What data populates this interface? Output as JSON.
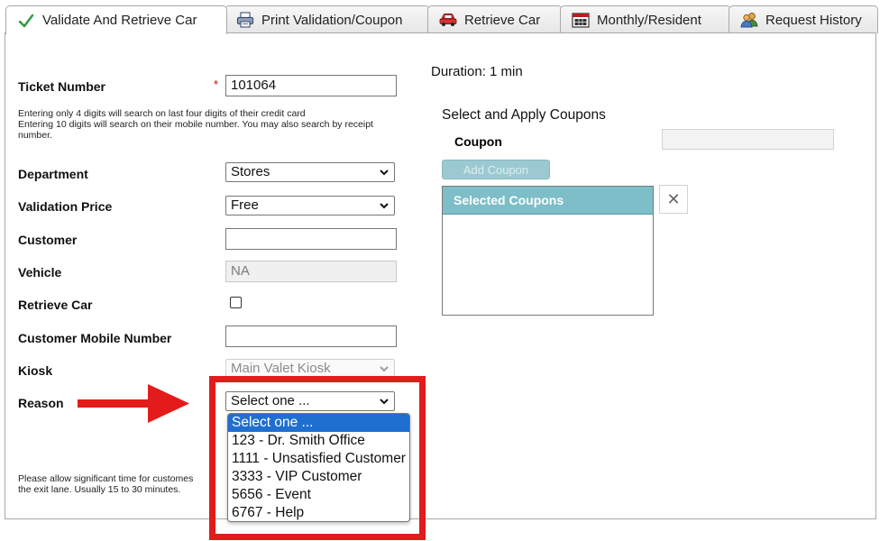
{
  "tabs": [
    {
      "label": "Validate And Retrieve Car",
      "icon": "checkmark-icon",
      "active": true
    },
    {
      "label": "Print Validation/Coupon",
      "icon": "printer-icon",
      "active": false
    },
    {
      "label": "Retrieve Car",
      "icon": "car-icon",
      "active": false
    },
    {
      "label": "Monthly/Resident",
      "icon": "calendar-icon",
      "active": false
    },
    {
      "label": "Request History",
      "icon": "users-icon",
      "active": false
    }
  ],
  "form": {
    "ticket_number": {
      "label": "Ticket Number",
      "value": "101064",
      "required_mark": "*"
    },
    "ticket_help": "Entering only 4 digits will search on last four digits of their credit card\nEntering 10 digits will search on their mobile number. You may also search by receipt\nnumber.",
    "department": {
      "label": "Department",
      "value": "Stores"
    },
    "validation_price": {
      "label": "Validation Price",
      "value": "Free"
    },
    "customer": {
      "label": "Customer",
      "value": ""
    },
    "vehicle": {
      "label": "Vehicle",
      "value": "NA"
    },
    "retrieve_car": {
      "label": "Retrieve Car",
      "checked": false
    },
    "customer_mobile": {
      "label": "Customer Mobile Number",
      "value": ""
    },
    "kiosk": {
      "label": "Kiosk",
      "value": "Main Valet Kiosk"
    },
    "reason": {
      "label": "Reason",
      "value": "Select one ...",
      "options": [
        "Select one ...",
        "123 - Dr. Smith Office",
        "1111 - Unsatisfied Customer",
        "3333 - VIP Customer",
        "5656 - Event",
        "6767 - Help"
      ]
    },
    "bottom_note_line1": "Please allow significant time for custome",
    "bottom_note_line1b": "s",
    "bottom_note_line2": "the exit lane. Usually 15 to 30 minutes."
  },
  "coupons": {
    "duration": "Duration: 1 min",
    "heading": "Select and Apply Coupons",
    "coupon_label": "Coupon",
    "coupon_value": "",
    "add_button": "Add Coupon",
    "selected_header": "Selected Coupons",
    "remove_button": "✕"
  },
  "colors": {
    "accent": "#7dbec8",
    "highlight_option": "#1f6fd1",
    "annotation_red": "#e31b1b",
    "checkmark_green": "#2e9a3a"
  }
}
